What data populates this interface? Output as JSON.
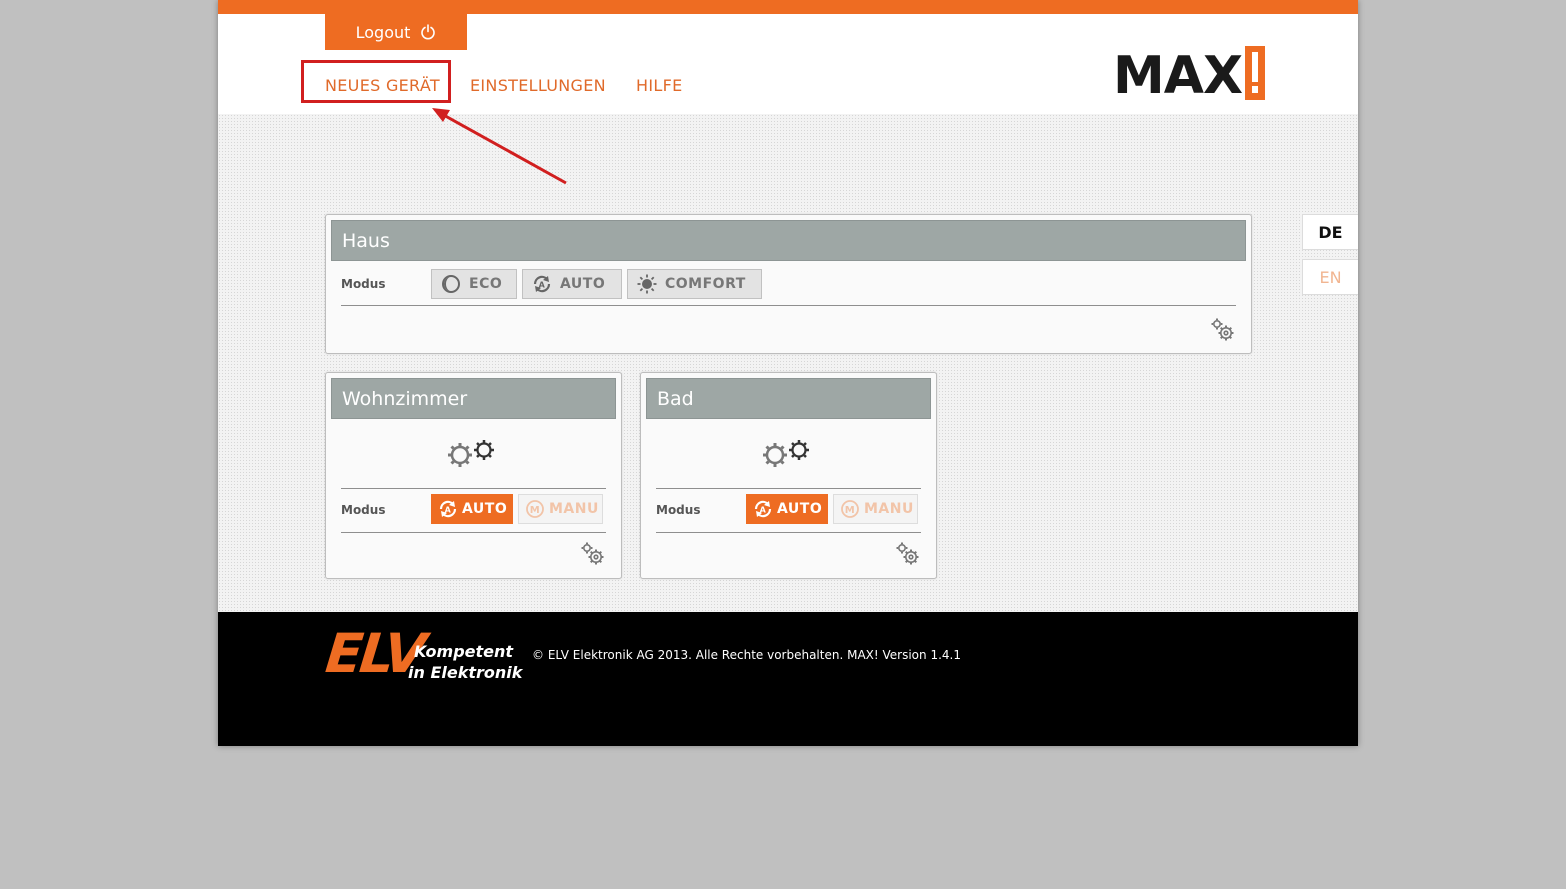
{
  "header": {
    "logout_label": "Logout",
    "nav": {
      "neues_geraet": "NEUES GERÄT",
      "einstellungen": "EINSTELLUNGEN",
      "hilfe": "HILFE"
    },
    "logo_text": "MAX"
  },
  "languages": {
    "de": "DE",
    "en": "EN",
    "active": "DE"
  },
  "house": {
    "title": "Haus",
    "modus_label": "Modus",
    "modes": {
      "eco": "ECO",
      "auto": "AUTO",
      "comfort": "COMFORT"
    }
  },
  "rooms": [
    {
      "title": "Wohnzimmer",
      "modus_label": "Modus",
      "auto_label": "AUTO",
      "manu_label": "MANU",
      "active_mode": "AUTO"
    },
    {
      "title": "Bad",
      "modus_label": "Modus",
      "auto_label": "AUTO",
      "manu_label": "MANU",
      "active_mode": "AUTO"
    }
  ],
  "footer": {
    "elv_logo": "ELV",
    "slogan_line1": "Kompetent",
    "slogan_line2": "in Elektronik",
    "copyright": "© ELV Elektronik AG 2013. Alle Rechte vorbehalten. MAX! Version 1.4.1"
  },
  "colors": {
    "accent": "#ee6c22",
    "panel_header": "#9ea7a5",
    "highlight": "#d11f1f"
  }
}
